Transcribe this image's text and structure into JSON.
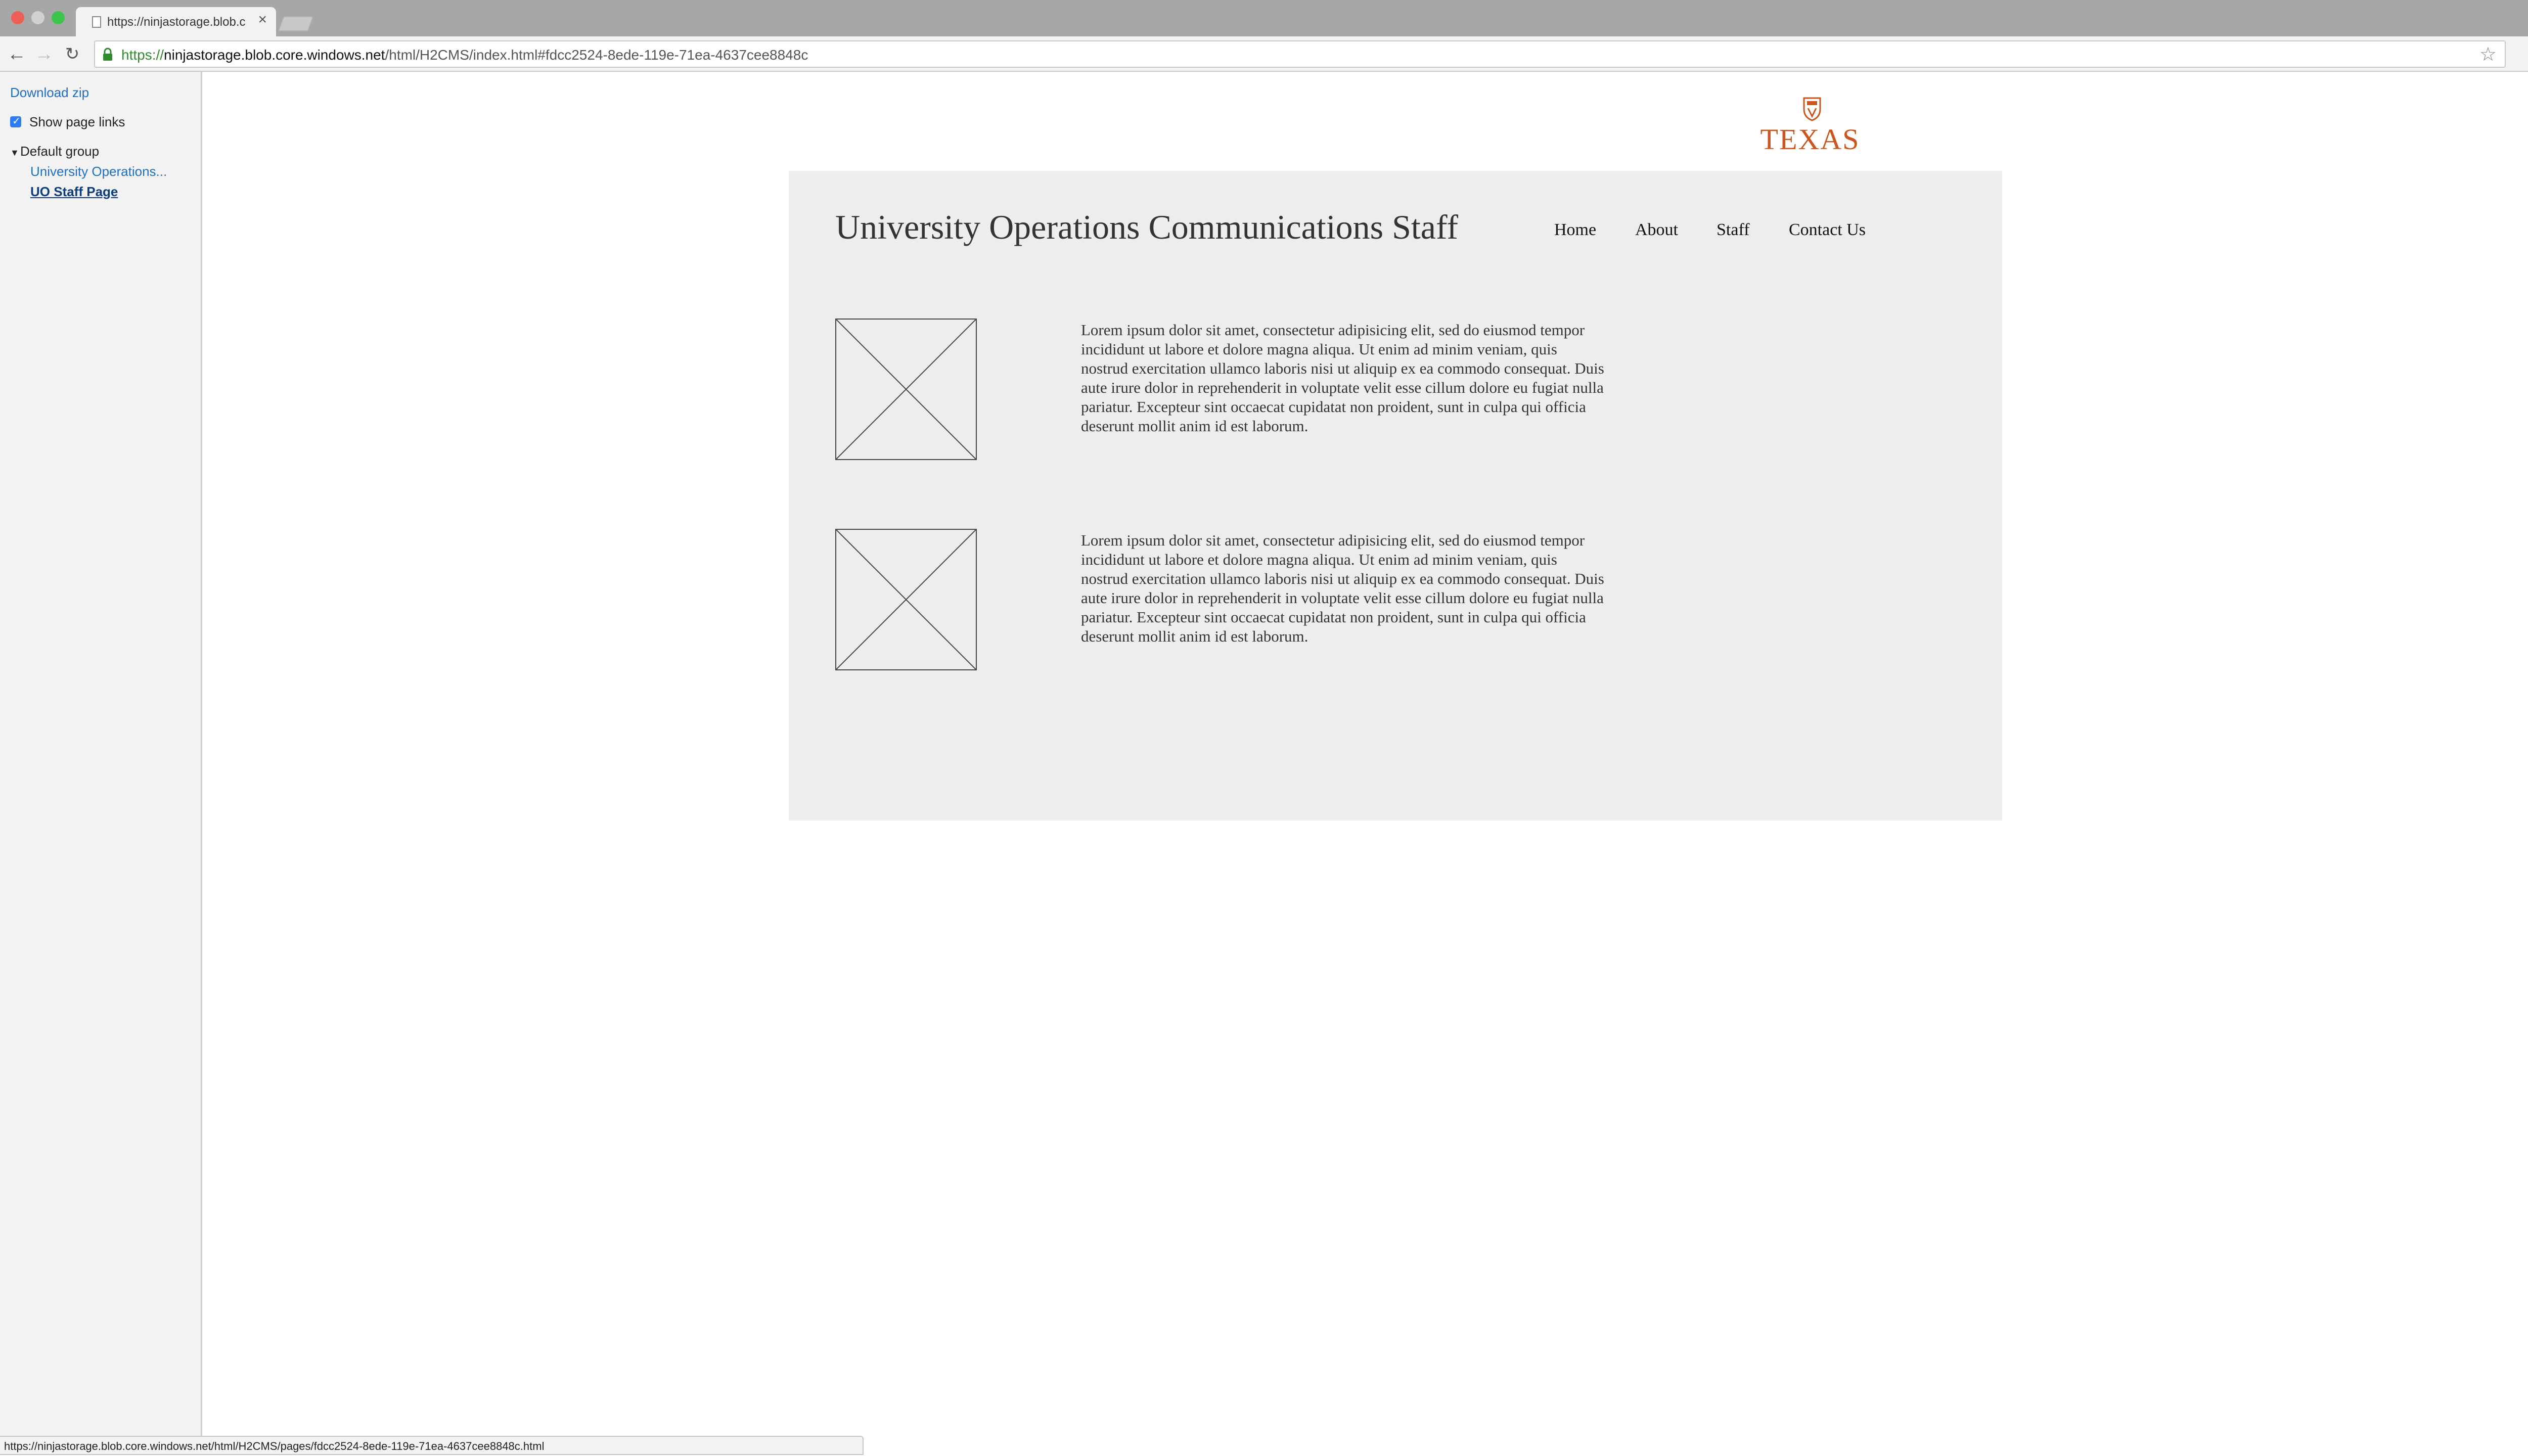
{
  "browser": {
    "tab_title": "https://ninjastorage.blob.c",
    "tab_close": "×",
    "url_scheme": "https://",
    "url_host": "ninjastorage.blob.core.windows.net",
    "url_path": "/html/H2CMS/index.html#fdcc2524-8ede-119e-71ea-4637cee8848c",
    "status_url": "https://ninjastorage.blob.core.windows.net/html/H2CMS/pages/fdcc2524-8ede-119e-71ea-4637cee8848c.html",
    "colors": {
      "secure_green": "#2e8b2e",
      "link_blue": "#1f6fc0"
    }
  },
  "sidebar": {
    "download": "Download zip",
    "show_links": "Show page links",
    "show_links_checked": true,
    "group": "Default group",
    "pages": [
      "University Operations...",
      "UO Staff Page"
    ]
  },
  "page": {
    "logo": "TEXAS",
    "title": "University Operations Communications Staff",
    "nav": [
      "Home",
      "About",
      "Staff",
      "Contact Us"
    ],
    "paragraphs": [
      "Lorem ipsum dolor sit amet, consectetur adipisicing elit, sed do eiusmod tempor incididunt ut labore et dolore magna aliqua. Ut enim ad minim veniam, quis nostrud exercitation ullamco laboris nisi ut aliquip ex ea commodo consequat. Duis aute irure dolor in reprehenderit in voluptate velit esse cillum dolore eu fugiat nulla pariatur. Excepteur sint occaecat cupidatat non proident, sunt in culpa qui officia deserunt mollit anim id est laborum.",
      "Lorem ipsum dolor sit amet, consectetur adipisicing elit, sed do eiusmod tempor incididunt ut labore et dolore magna aliqua. Ut enim ad minim veniam, quis nostrud exercitation ullamco laboris nisi ut aliquip ex ea commodo consequat. Duis aute irure dolor in reprehenderit in voluptate velit esse cillum dolore eu fugiat nulla pariatur. Excepteur sint occaecat cupidatat non proident, sunt in culpa qui officia deserunt mollit anim id est laborum."
    ],
    "colors": {
      "logo_orange": "#c9561e",
      "panel_bg": "#ededed"
    }
  },
  "icons": [
    "page-icon",
    "back-icon",
    "forward-icon",
    "reload-icon",
    "lock-icon",
    "star-icon",
    "extension-icon",
    "menu-icon",
    "profile-icon",
    "checkbox-icon",
    "caret-down-icon",
    "shield-icon",
    "image-placeholder-icon"
  ]
}
